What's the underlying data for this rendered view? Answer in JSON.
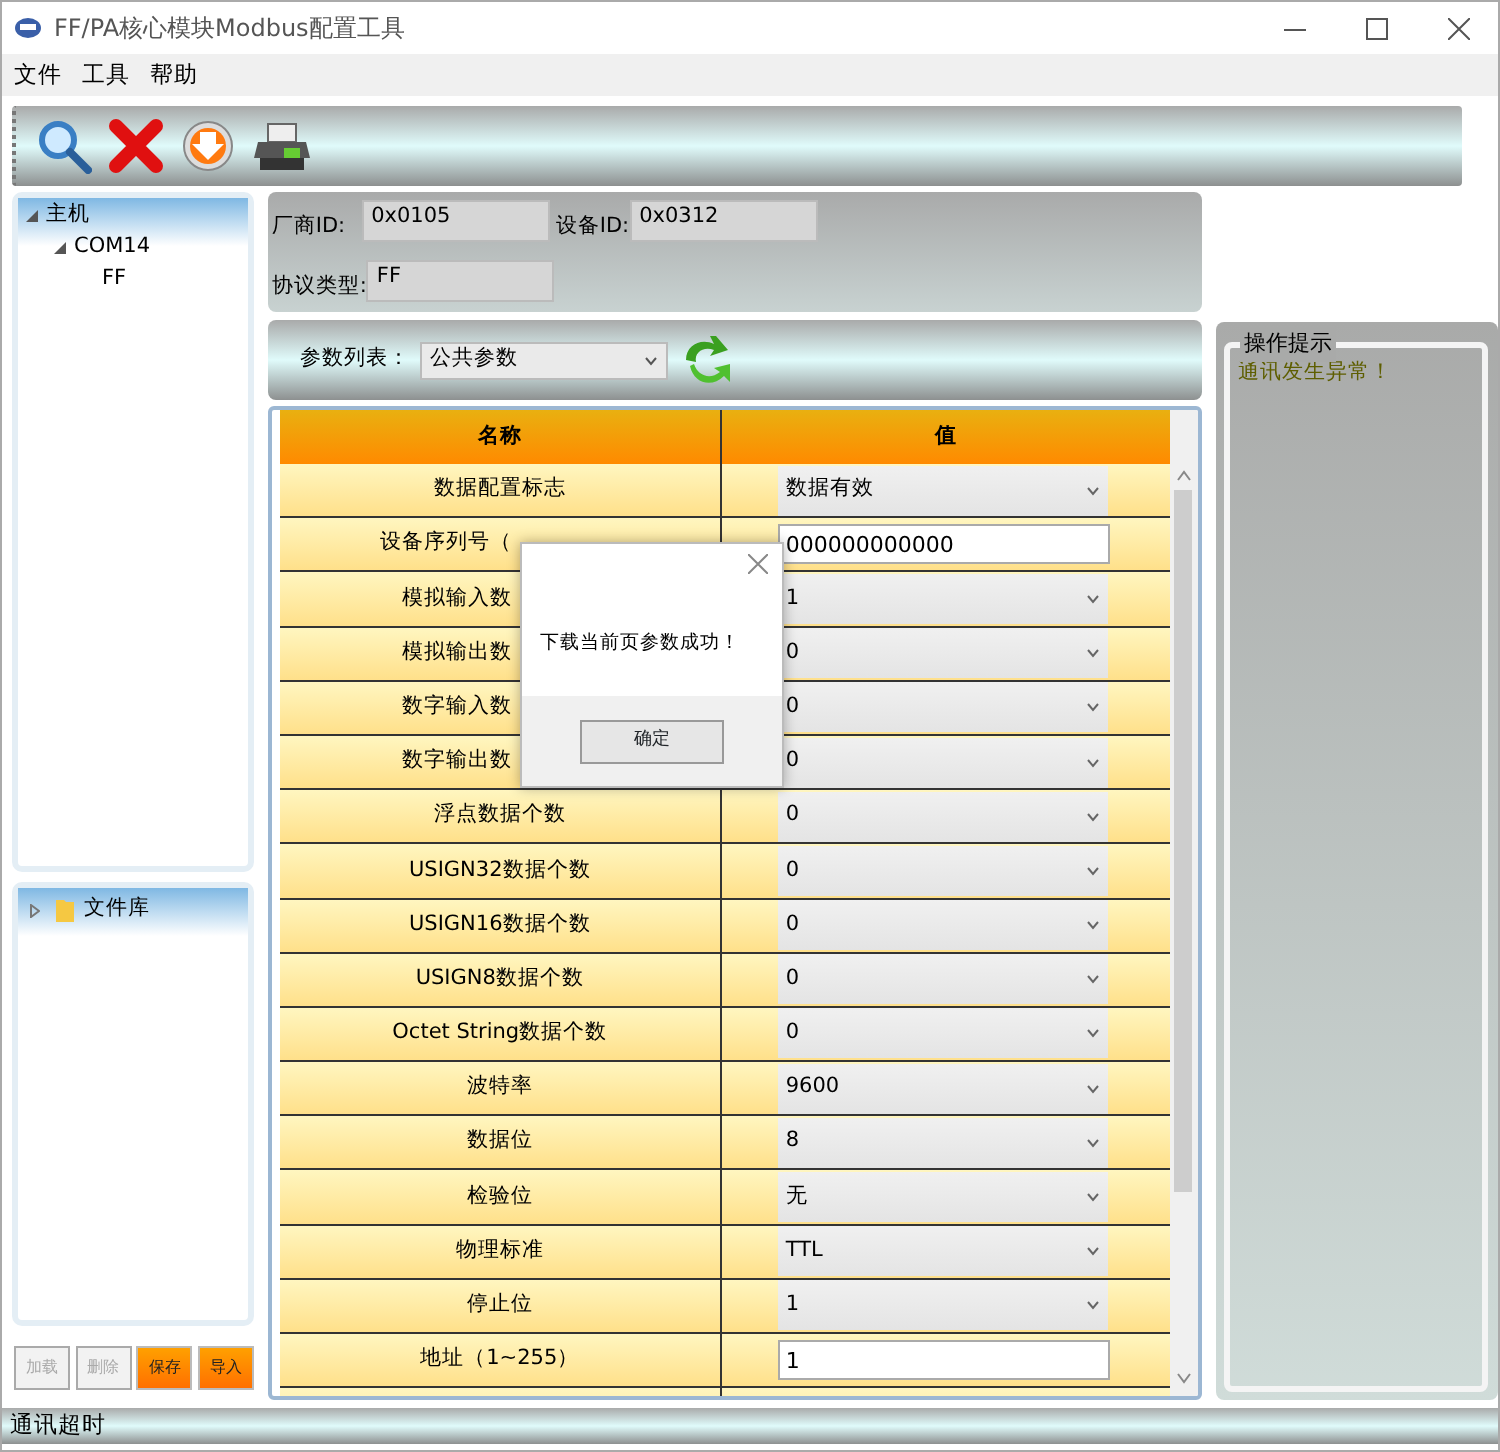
{
  "window": {
    "title": "FF/PA核心模块Modbus配置工具"
  },
  "menu": [
    "文件",
    "工具",
    "帮助"
  ],
  "tree": [
    {
      "label": "主机",
      "expanded": true,
      "children": [
        {
          "label": "COM14",
          "expanded": true,
          "children": [
            {
              "label": "FF"
            }
          ]
        }
      ]
    }
  ],
  "library": [
    {
      "label": "文件库",
      "expanded": false
    }
  ],
  "side_buttons": [
    {
      "label": "加载",
      "disabled": true
    },
    {
      "label": "删除",
      "disabled": true
    },
    {
      "label": "保存",
      "disabled": false
    },
    {
      "label": "导入",
      "disabled": false
    }
  ],
  "device": {
    "fields": [
      {
        "label": "厂商ID:",
        "value": "0x0105"
      },
      {
        "label": "设备ID:",
        "value": "0x0312"
      },
      {
        "label": "协议类型:",
        "value": "FF"
      }
    ]
  },
  "param_list": {
    "label": "参数列表：",
    "value": "公共参数"
  },
  "table": {
    "columns": [
      "名称",
      "值"
    ],
    "rows": [
      {
        "name": "数据配置标志",
        "value": "数据有效",
        "kind": "select",
        "covered": false
      },
      {
        "name": "设备序列号（",
        "value": "000000000000",
        "kind": "input",
        "covered": true
      },
      {
        "name": "模拟输入数",
        "value": "1",
        "kind": "select",
        "covered": true
      },
      {
        "name": "模拟输出数",
        "value": "0",
        "kind": "select",
        "covered": true
      },
      {
        "name": "数字输入数",
        "value": "0",
        "kind": "select",
        "covered": true
      },
      {
        "name": "数字输出数",
        "value": "0",
        "kind": "select",
        "covered": true
      },
      {
        "name": "浮点数据个数",
        "value": "0",
        "kind": "select",
        "covered": false
      },
      {
        "name": "USIGN32数据个数",
        "value": "0",
        "kind": "select",
        "covered": false
      },
      {
        "name": "USIGN16数据个数",
        "value": "0",
        "kind": "select",
        "covered": false
      },
      {
        "name": "USIGN8数据个数",
        "value": "0",
        "kind": "select",
        "covered": false
      },
      {
        "name": "Octet String数据个数",
        "value": "0",
        "kind": "select",
        "covered": false
      },
      {
        "name": "波特率",
        "value": "9600",
        "kind": "select",
        "covered": false
      },
      {
        "name": "数据位",
        "value": "8",
        "kind": "select",
        "covered": false
      },
      {
        "name": "检验位",
        "value": "无",
        "kind": "select",
        "covered": false
      },
      {
        "name": "物理标准",
        "value": "TTL",
        "kind": "select",
        "covered": false
      },
      {
        "name": "停止位",
        "value": "1",
        "kind": "select",
        "covered": false
      },
      {
        "name": "地址（1~255）",
        "value": "1",
        "kind": "input",
        "covered": false
      }
    ]
  },
  "dialog": {
    "message": "下载当前页参数成功！",
    "buttons": [
      "确定"
    ]
  },
  "hint_panel": {
    "title": "操作提示",
    "message": "通讯发生异常！"
  },
  "status_bar": "通讯超时"
}
